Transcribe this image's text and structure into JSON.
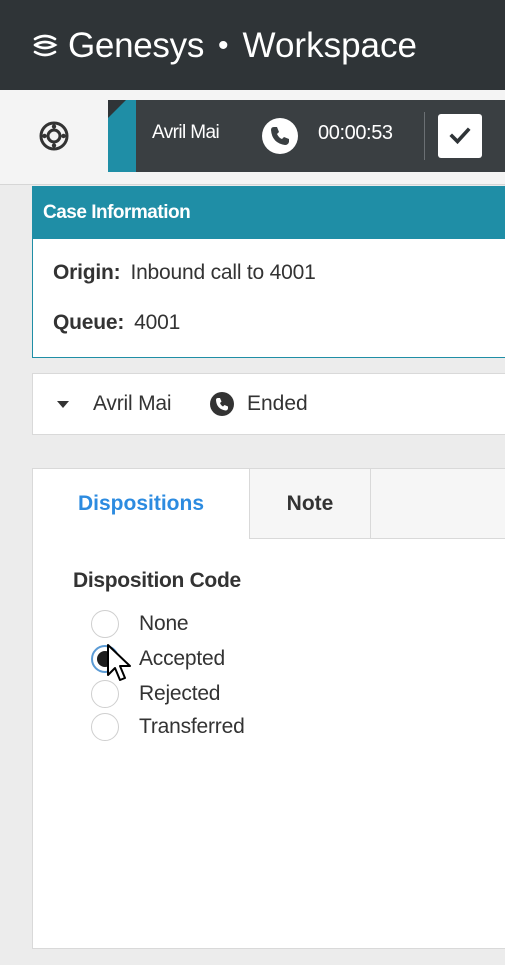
{
  "header": {
    "brand": "Genesys",
    "trademark": "·",
    "separator": "•",
    "product": "Workspace"
  },
  "toolbar": {
    "support_icon": "lifebuoy-icon",
    "call": {
      "contact_name": "Avril Mai",
      "phone_icon": "phone-icon",
      "timer": "00:00:53",
      "done_icon": "check-icon"
    }
  },
  "case_information": {
    "title": "Case Information",
    "origin_label": "Origin:",
    "origin_value": "Inbound call to 4001",
    "queue_label": "Queue:",
    "queue_value": "4001"
  },
  "party": {
    "caret_icon": "caret-down-icon",
    "name": "Avril Mai",
    "status_icon": "phone-ended-icon",
    "status": "Ended"
  },
  "tabs": [
    {
      "label": "Dispositions",
      "active": true
    },
    {
      "label": "Note",
      "active": false
    }
  ],
  "dispositions": {
    "title": "Disposition Code",
    "options": [
      {
        "label": "None",
        "checked": false
      },
      {
        "label": "Accepted",
        "checked": true
      },
      {
        "label": "Rejected",
        "checked": false
      },
      {
        "label": "Transferred",
        "checked": false
      }
    ]
  },
  "colors": {
    "header_bg": "#2f3437",
    "call_bar_bg": "#3a3f42",
    "accent_teal": "#1f8ea6",
    "active_tab_text": "#2c8be0",
    "radio_selected_ring": "#5b9bd5"
  }
}
